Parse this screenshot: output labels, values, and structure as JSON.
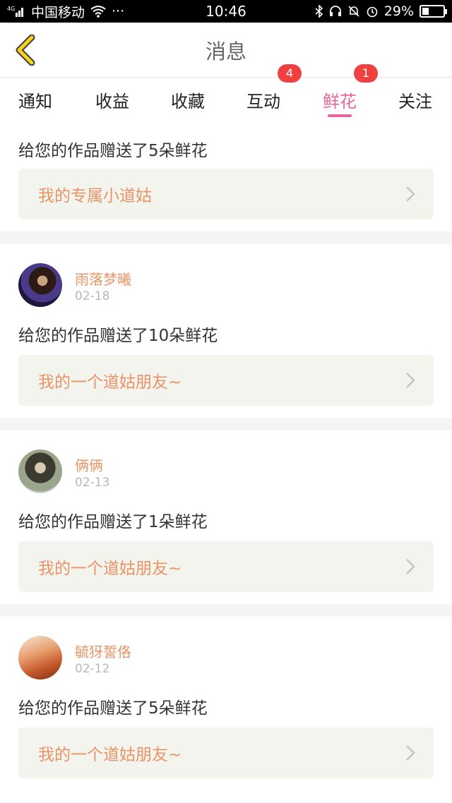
{
  "status_bar": {
    "carrier": "中国移动",
    "network": "4G",
    "time": "10:46",
    "battery": "29%",
    "more": "···"
  },
  "header": {
    "title": "消息",
    "back_icon": "chevron-left-icon",
    "accent_color": "#f5d21f"
  },
  "tabs": [
    {
      "label": "通知",
      "badge": ""
    },
    {
      "label": "收益",
      "badge": ""
    },
    {
      "label": "收藏",
      "badge": ""
    },
    {
      "label": "互动",
      "badge": "4"
    },
    {
      "label": "鲜花",
      "badge": "1",
      "active": true
    },
    {
      "label": "关注",
      "badge": ""
    }
  ],
  "colors": {
    "active_tab": "#e8669b",
    "badge": "#f0403f",
    "username": "#e89466",
    "link_text": "#e89466"
  },
  "items": [
    {
      "message": "给您的作品赠送了5朵鲜花",
      "work_title": "我的专属小道姑"
    },
    {
      "username": "雨落梦曦",
      "date": "02-18",
      "message": "给您的作品赠送了10朵鲜花",
      "work_title": "我的一个道姑朋友~"
    },
    {
      "username": "俩俩",
      "date": "02-13",
      "message": "给您的作品赠送了1朵鲜花",
      "work_title": "我的一个道姑朋友~"
    },
    {
      "username": "毓犽誓佫",
      "date": "02-12",
      "message": "给您的作品赠送了5朵鲜花",
      "work_title": "我的一个道姑朋友~"
    }
  ]
}
